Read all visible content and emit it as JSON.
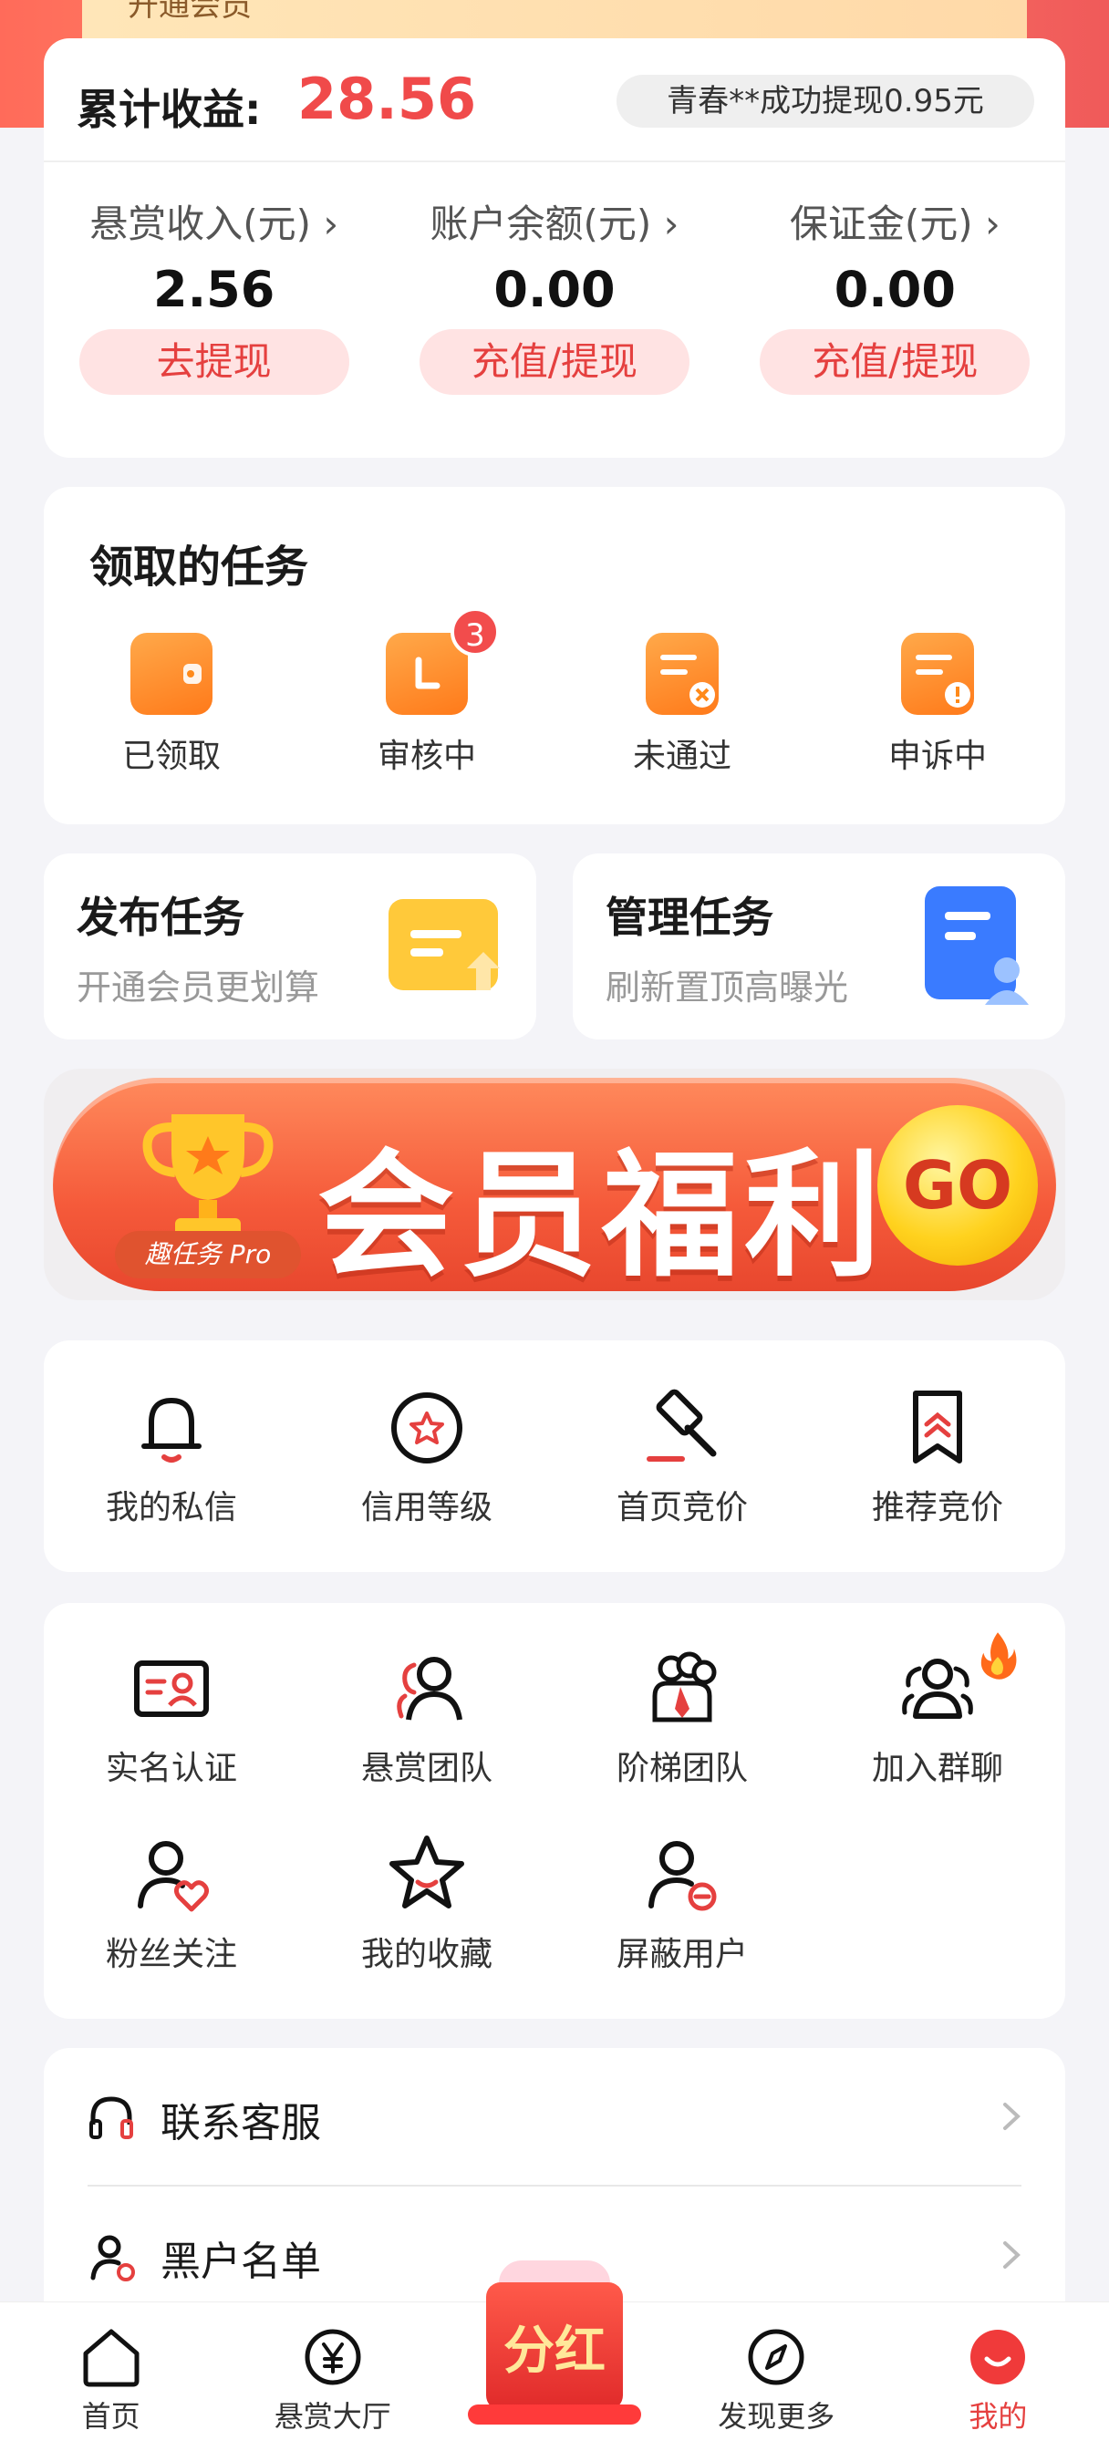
{
  "top_banner_peek": "开通会员",
  "earnings": {
    "title": "累计收益:",
    "total": "28.56",
    "ticker": "青春**成功提现0.95元",
    "columns": [
      {
        "label": "悬赏收入(元)",
        "amount": "2.56",
        "button": "去提现"
      },
      {
        "label": "账户余额(元)",
        "amount": "0.00",
        "button": "充值/提现"
      },
      {
        "label": "保证金(元)",
        "amount": "0.00",
        "button": "充值/提现"
      }
    ]
  },
  "tasks": {
    "title": "领取的任务",
    "items": [
      {
        "label": "已领取",
        "icon": "wallet-icon"
      },
      {
        "label": "审核中",
        "icon": "review-icon",
        "badge": "3"
      },
      {
        "label": "未通过",
        "icon": "rejected-doc-icon"
      },
      {
        "label": "申诉中",
        "icon": "appeal-doc-icon"
      }
    ]
  },
  "publish": {
    "title": "发布任务",
    "subtitle": "开通会员更划算"
  },
  "manage": {
    "title": "管理任务",
    "subtitle": "刷新置顶高曝光"
  },
  "banner": {
    "text": "会员福利",
    "go": "GO",
    "tag": "趣任务 Pro"
  },
  "features1": [
    {
      "label": "我的私信",
      "icon": "bell-icon"
    },
    {
      "label": "信用等级",
      "icon": "credit-star-icon"
    },
    {
      "label": "首页竞价",
      "icon": "gavel-icon"
    },
    {
      "label": "推荐竞价",
      "icon": "bookmark-up-icon"
    }
  ],
  "features2": [
    {
      "label": "实名认证",
      "icon": "id-card-icon"
    },
    {
      "label": "悬赏团队",
      "icon": "team-icon"
    },
    {
      "label": "阶梯团队",
      "icon": "ladder-team-icon"
    },
    {
      "label": "加入群聊",
      "icon": "group-chat-icon"
    },
    {
      "label": "粉丝关注",
      "icon": "fans-heart-icon"
    },
    {
      "label": "我的收藏",
      "icon": "star-icon"
    },
    {
      "label": "屏蔽用户",
      "icon": "block-user-icon"
    }
  ],
  "list": [
    {
      "label": "联系客服",
      "icon": "headset-icon"
    },
    {
      "label": "黑户名单",
      "icon": "blacklist-user-icon"
    }
  ],
  "tabbar": {
    "tabs": [
      {
        "label": "首页",
        "icon": "home-icon"
      },
      {
        "label": "悬赏大厅",
        "icon": "yuan-icon"
      },
      {
        "label": "分红",
        "icon": "red-envelope-icon"
      },
      {
        "label": "发现更多",
        "icon": "compass-icon"
      },
      {
        "label": "我的",
        "icon": "profile-icon"
      }
    ],
    "active": "我的"
  },
  "colors": {
    "accent": "#e5403f",
    "orange": "#ff8a1a",
    "bg": "#f4f4f8"
  }
}
